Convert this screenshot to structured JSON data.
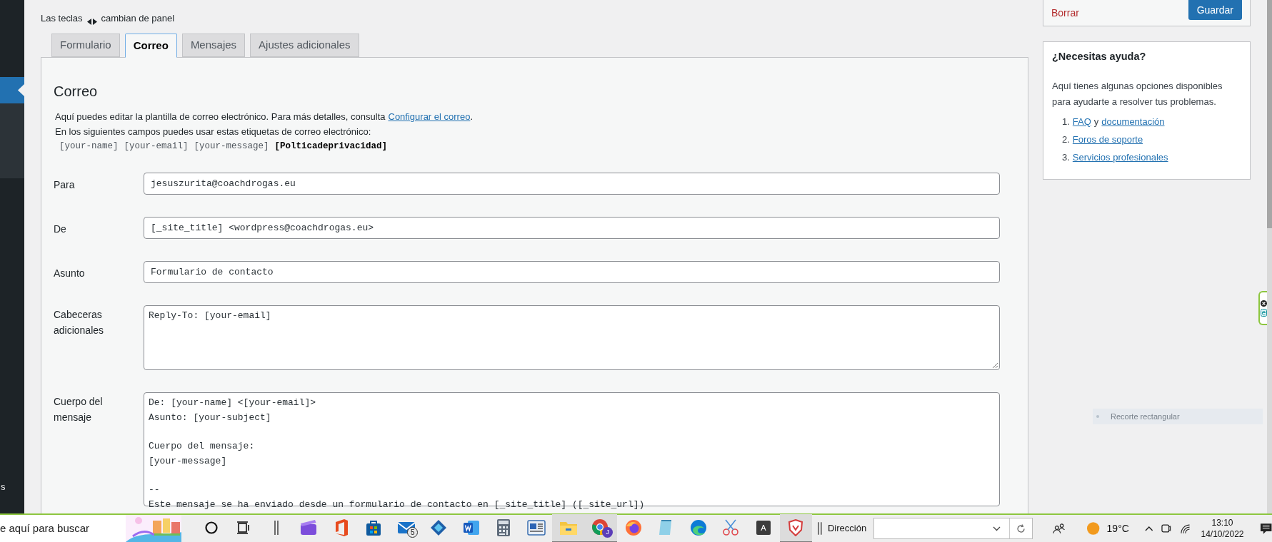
{
  "sidebar_fragment": "s",
  "keyboard_hint": {
    "before": "Las teclas",
    "after": "cambian de panel"
  },
  "tabs": [
    {
      "label": "Formulario",
      "selected": false
    },
    {
      "label": "Correo",
      "selected": true
    },
    {
      "label": "Mensajes",
      "selected": false
    },
    {
      "label": "Ajustes adicionales",
      "selected": false
    }
  ],
  "panel": {
    "title": "Correo",
    "intro": "Aquí puedes editar la plantilla de correo electrónico. Para más detalles, consulta",
    "intro_link": "Configurar el correo",
    "intro_end": ".",
    "tags_intro": "En los siguientes campos puedes usar estas etiquetas de correo electrónico:",
    "tags": [
      {
        "text": "[your-name]",
        "bold": false
      },
      {
        "text": "[your-email]",
        "bold": false
      },
      {
        "text": "[your-message]",
        "bold": false
      },
      {
        "text": "[Polticadeprivacidad]",
        "bold": true
      }
    ],
    "fields": [
      {
        "label": "Para",
        "kind": "input",
        "value": "jesuszurita@coachdrogas.eu"
      },
      {
        "label": "De",
        "kind": "input",
        "value": "[_site_title] <wordpress@coachdrogas.eu>"
      },
      {
        "label": "Asunto",
        "kind": "input",
        "value": "Formulario de contacto"
      },
      {
        "label": "Cabeceras adicionales",
        "kind": "textarea",
        "blocks": [
          [
            "Reply-To: [your-email]"
          ]
        ]
      },
      {
        "label": "Cuerpo del mensaje",
        "kind": "textarea",
        "blocks": [
          [
            "De: [your-name] <[your-email]>",
            "Asunto: [your-subject]"
          ],
          [
            "Cuerpo del mensaje:",
            "[your-message]"
          ],
          [
            "--",
            "Este mensaje se ha enviado desde un formulario de contacto en [_site_title] ([_site_url])"
          ]
        ]
      }
    ]
  },
  "actions": {
    "delete": "Borrar",
    "save": "Guardar"
  },
  "help": {
    "title": "¿Necesitas ayuda?",
    "text": "Aquí tienes algunas opciones disponibles para ayudarte a resolver tus problemas.",
    "items": [
      {
        "number": "1.",
        "links": [
          "FAQ",
          "documentación"
        ],
        "joiner": "y"
      },
      {
        "number": "2.",
        "links": [
          "Foros de soporte"
        ]
      },
      {
        "number": "3.",
        "links": [
          "Servicios profesionales"
        ]
      }
    ]
  },
  "overlay_tooltip": "Recorte rectangular",
  "taskbar": {
    "search_text": "e aquí para buscar",
    "apps": [
      {
        "kind": "cortana",
        "running": false
      },
      {
        "kind": "taskview",
        "running": false
      },
      {
        "kind": "grip",
        "running": false
      },
      {
        "kind": "clapper",
        "running": false
      },
      {
        "kind": "office",
        "running": false
      },
      {
        "kind": "store",
        "running": false
      },
      {
        "kind": "mail",
        "running": false,
        "badge": "5"
      },
      {
        "kind": "diamond",
        "running": false
      },
      {
        "kind": "word",
        "running": false
      },
      {
        "kind": "calculator",
        "running": false
      },
      {
        "kind": "news",
        "running": false
      },
      {
        "kind": "folder",
        "running": true
      },
      {
        "kind": "chrome",
        "running": true,
        "badge": "J"
      },
      {
        "kind": "firefox",
        "running": false
      },
      {
        "kind": "notepad",
        "running": false
      },
      {
        "kind": "edge",
        "running": false
      },
      {
        "kind": "scissors",
        "running": false
      },
      {
        "kind": "letter",
        "running": false,
        "letter": "A"
      },
      {
        "kind": "shield",
        "running": true
      }
    ],
    "address_label": "Dirección",
    "weather": "19°C",
    "time": "13:10",
    "date": "14/10/2022"
  }
}
